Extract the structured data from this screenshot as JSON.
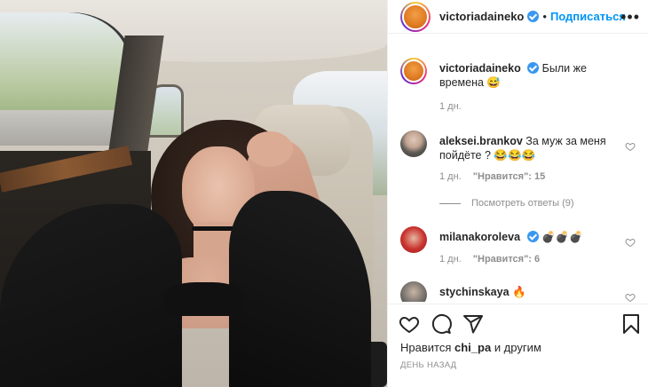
{
  "post": {
    "author": "victoriadaineko",
    "follow_label": "Подписаться",
    "dot": "•",
    "more_label": "•••"
  },
  "caption": {
    "username": "victoriadaineko",
    "text": "Были же времена 😅",
    "time": "1 дн."
  },
  "comments": [
    {
      "username": "aleksei.brankov",
      "text": "За муж за меня пойдёте ? 😂😂😂",
      "time": "1 дн.",
      "likes": "\"Нравится\": 15",
      "replies": "Посмотреть ответы (9)"
    },
    {
      "username": "milanakoroleva",
      "text": "💣💣💣",
      "time": "1 дн.",
      "likes": "\"Нравится\": 6"
    },
    {
      "username": "stychinskaya",
      "text": "🔥"
    }
  ],
  "footer": {
    "likes_prefix": "Нравится",
    "likes_user": "chi_pa",
    "likes_suffix": "и другим",
    "timestamp": "ДЕНЬ НАЗАД"
  },
  "colors": {
    "follow": "#0095f6",
    "verified": "#3897f0",
    "muted": "#8e8e8e",
    "text": "#262626"
  },
  "icons": [
    "heart-icon",
    "comment-icon",
    "share-icon",
    "bookmark-icon",
    "more-icon",
    "verified-badge-icon"
  ]
}
